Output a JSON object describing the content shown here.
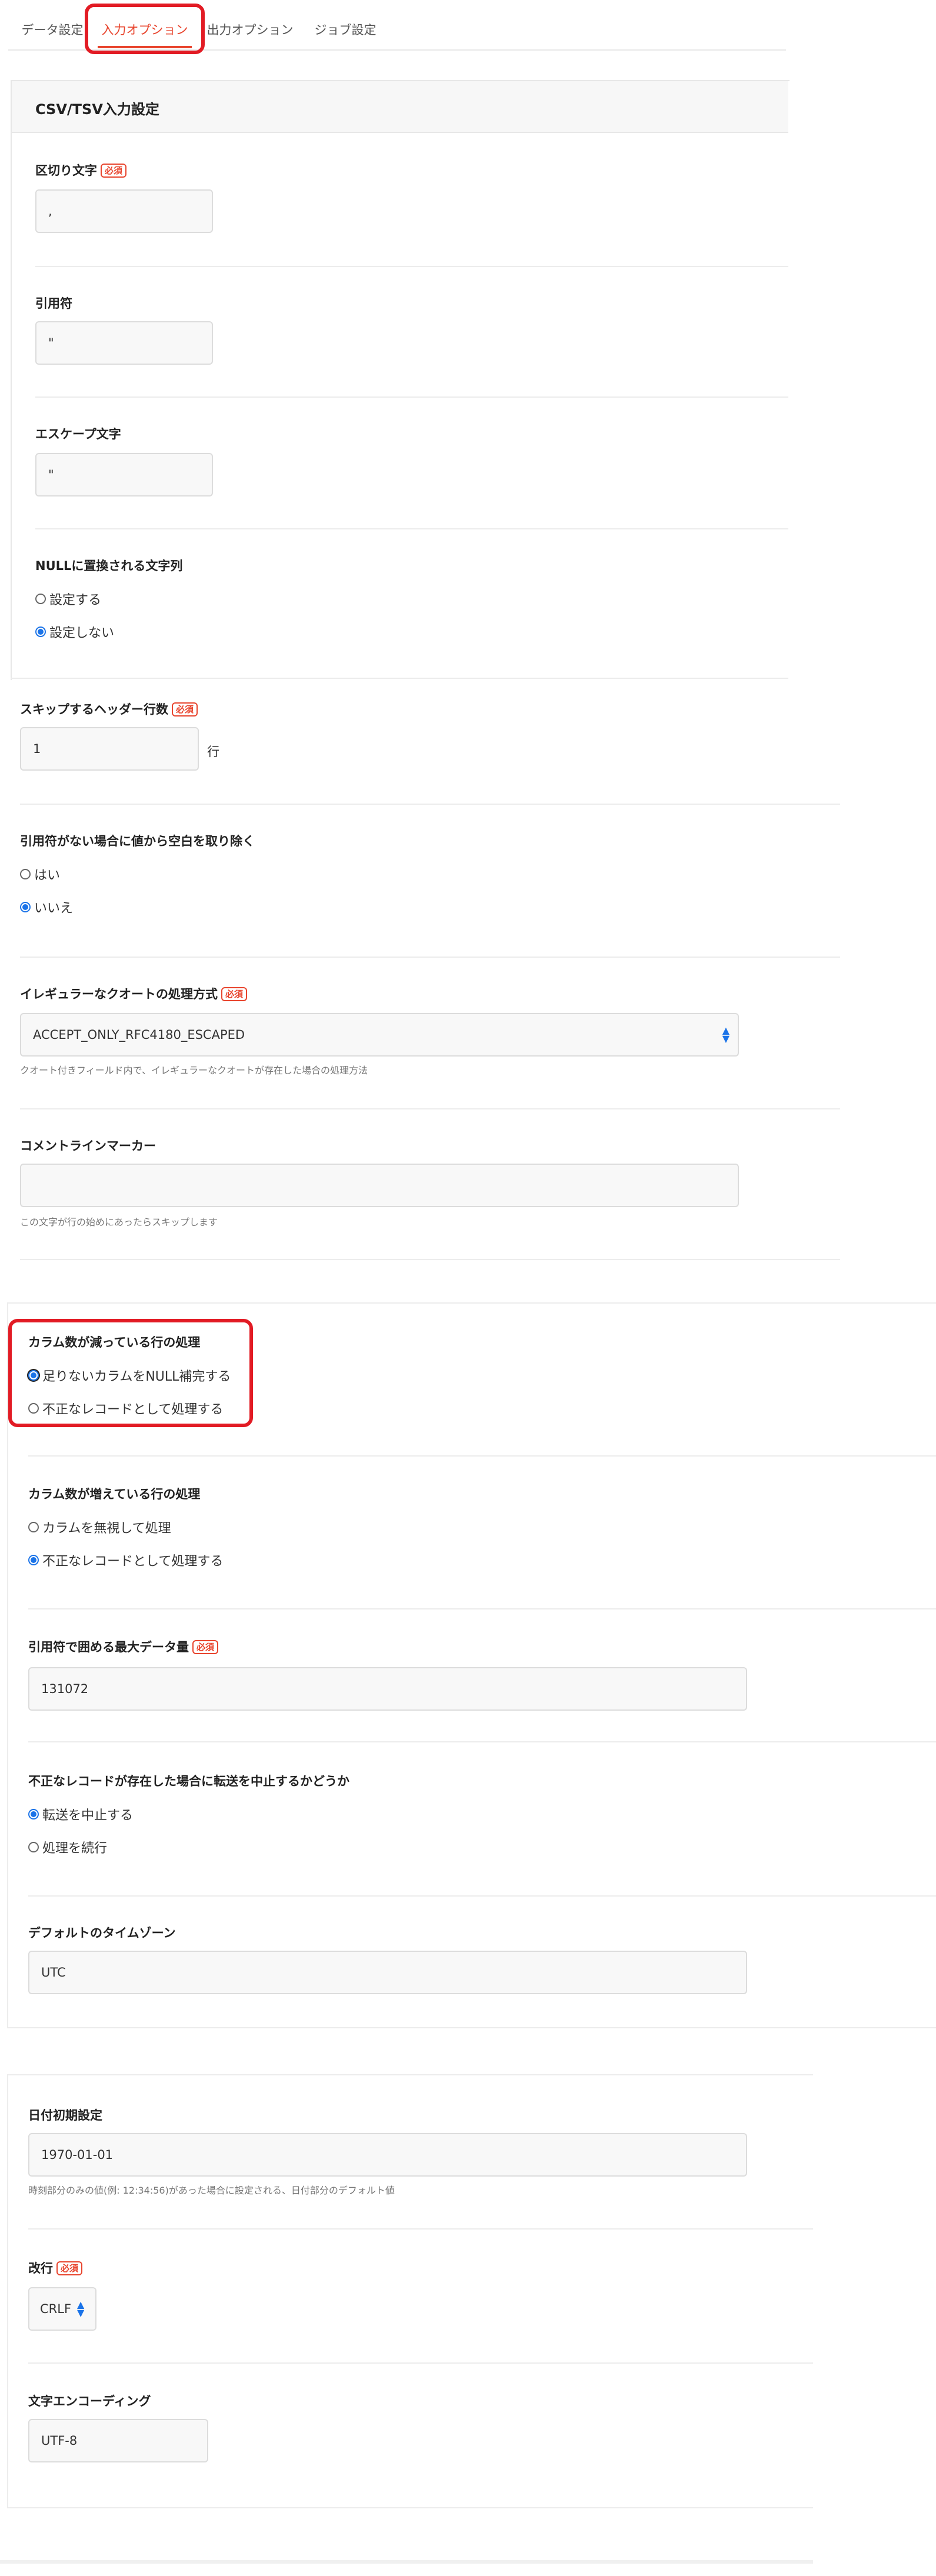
{
  "tabs": [
    {
      "label": "データ設定"
    },
    {
      "label": "入力オプション"
    },
    {
      "label": "出力オプション"
    },
    {
      "label": "ジョブ設定"
    }
  ],
  "required_badge": "必須",
  "csv_section": {
    "title": "CSV/TSV入力設定",
    "delimiter": {
      "label": "区切り文字",
      "value": ","
    },
    "quote": {
      "label": "引用符",
      "value": "\""
    },
    "escape": {
      "label": "エスケープ文字",
      "value": "\""
    },
    "null_string": {
      "label": "NULLに置換される文字列",
      "options": [
        "設定する",
        "設定しない"
      ],
      "selected": 1
    }
  },
  "skip_header": {
    "label": "スキップするヘッダー行数",
    "value": "1",
    "unit": "行"
  },
  "trim_unquoted": {
    "label": "引用符がない場合に値から空白を取り除く",
    "options": [
      "はい",
      "いいえ"
    ],
    "selected": 1
  },
  "irregular_quote": {
    "label": "イレギュラーなクオートの処理方式",
    "value": "ACCEPT_ONLY_RFC4180_ESCAPED",
    "help": "クオート付きフィールド内で、イレギュラーなクオートが存在した場合の処理方法"
  },
  "comment_marker": {
    "label": "コメントラインマーカー",
    "value": "",
    "help": "この文字が行の始めにあったらスキップします"
  },
  "fewer_columns": {
    "label": "カラム数が減っている行の処理",
    "options": [
      "足りないカラムをNULL補完する",
      "不正なレコードとして処理する"
    ],
    "selected": 0
  },
  "more_columns": {
    "label": "カラム数が増えている行の処理",
    "options": [
      "カラムを無視して処理",
      "不正なレコードとして処理する"
    ],
    "selected": 1
  },
  "max_quoted_size": {
    "label": "引用符で囲める最大データ量",
    "value": "131072"
  },
  "stop_on_invalid": {
    "label": "不正なレコードが存在した場合に転送を中止するかどうか",
    "options": [
      "転送を中止する",
      "処理を続行"
    ],
    "selected": 0
  },
  "default_timezone": {
    "label": "デフォルトのタイムゾーン",
    "value": "UTC"
  },
  "default_date": {
    "label": "日付初期設定",
    "value": "1970-01-01",
    "help": "時刻部分のみの値(例: 12:34:56)があった場合に設定される、日付部分のデフォルト値"
  },
  "newline": {
    "label": "改行",
    "value": "CRLF"
  },
  "encoding": {
    "label": "文字エンコーディング",
    "value": "UTF-8"
  },
  "colors": {
    "accent": "#e8442d",
    "highlight": "#e21b24",
    "radio": "#1a73e8"
  }
}
